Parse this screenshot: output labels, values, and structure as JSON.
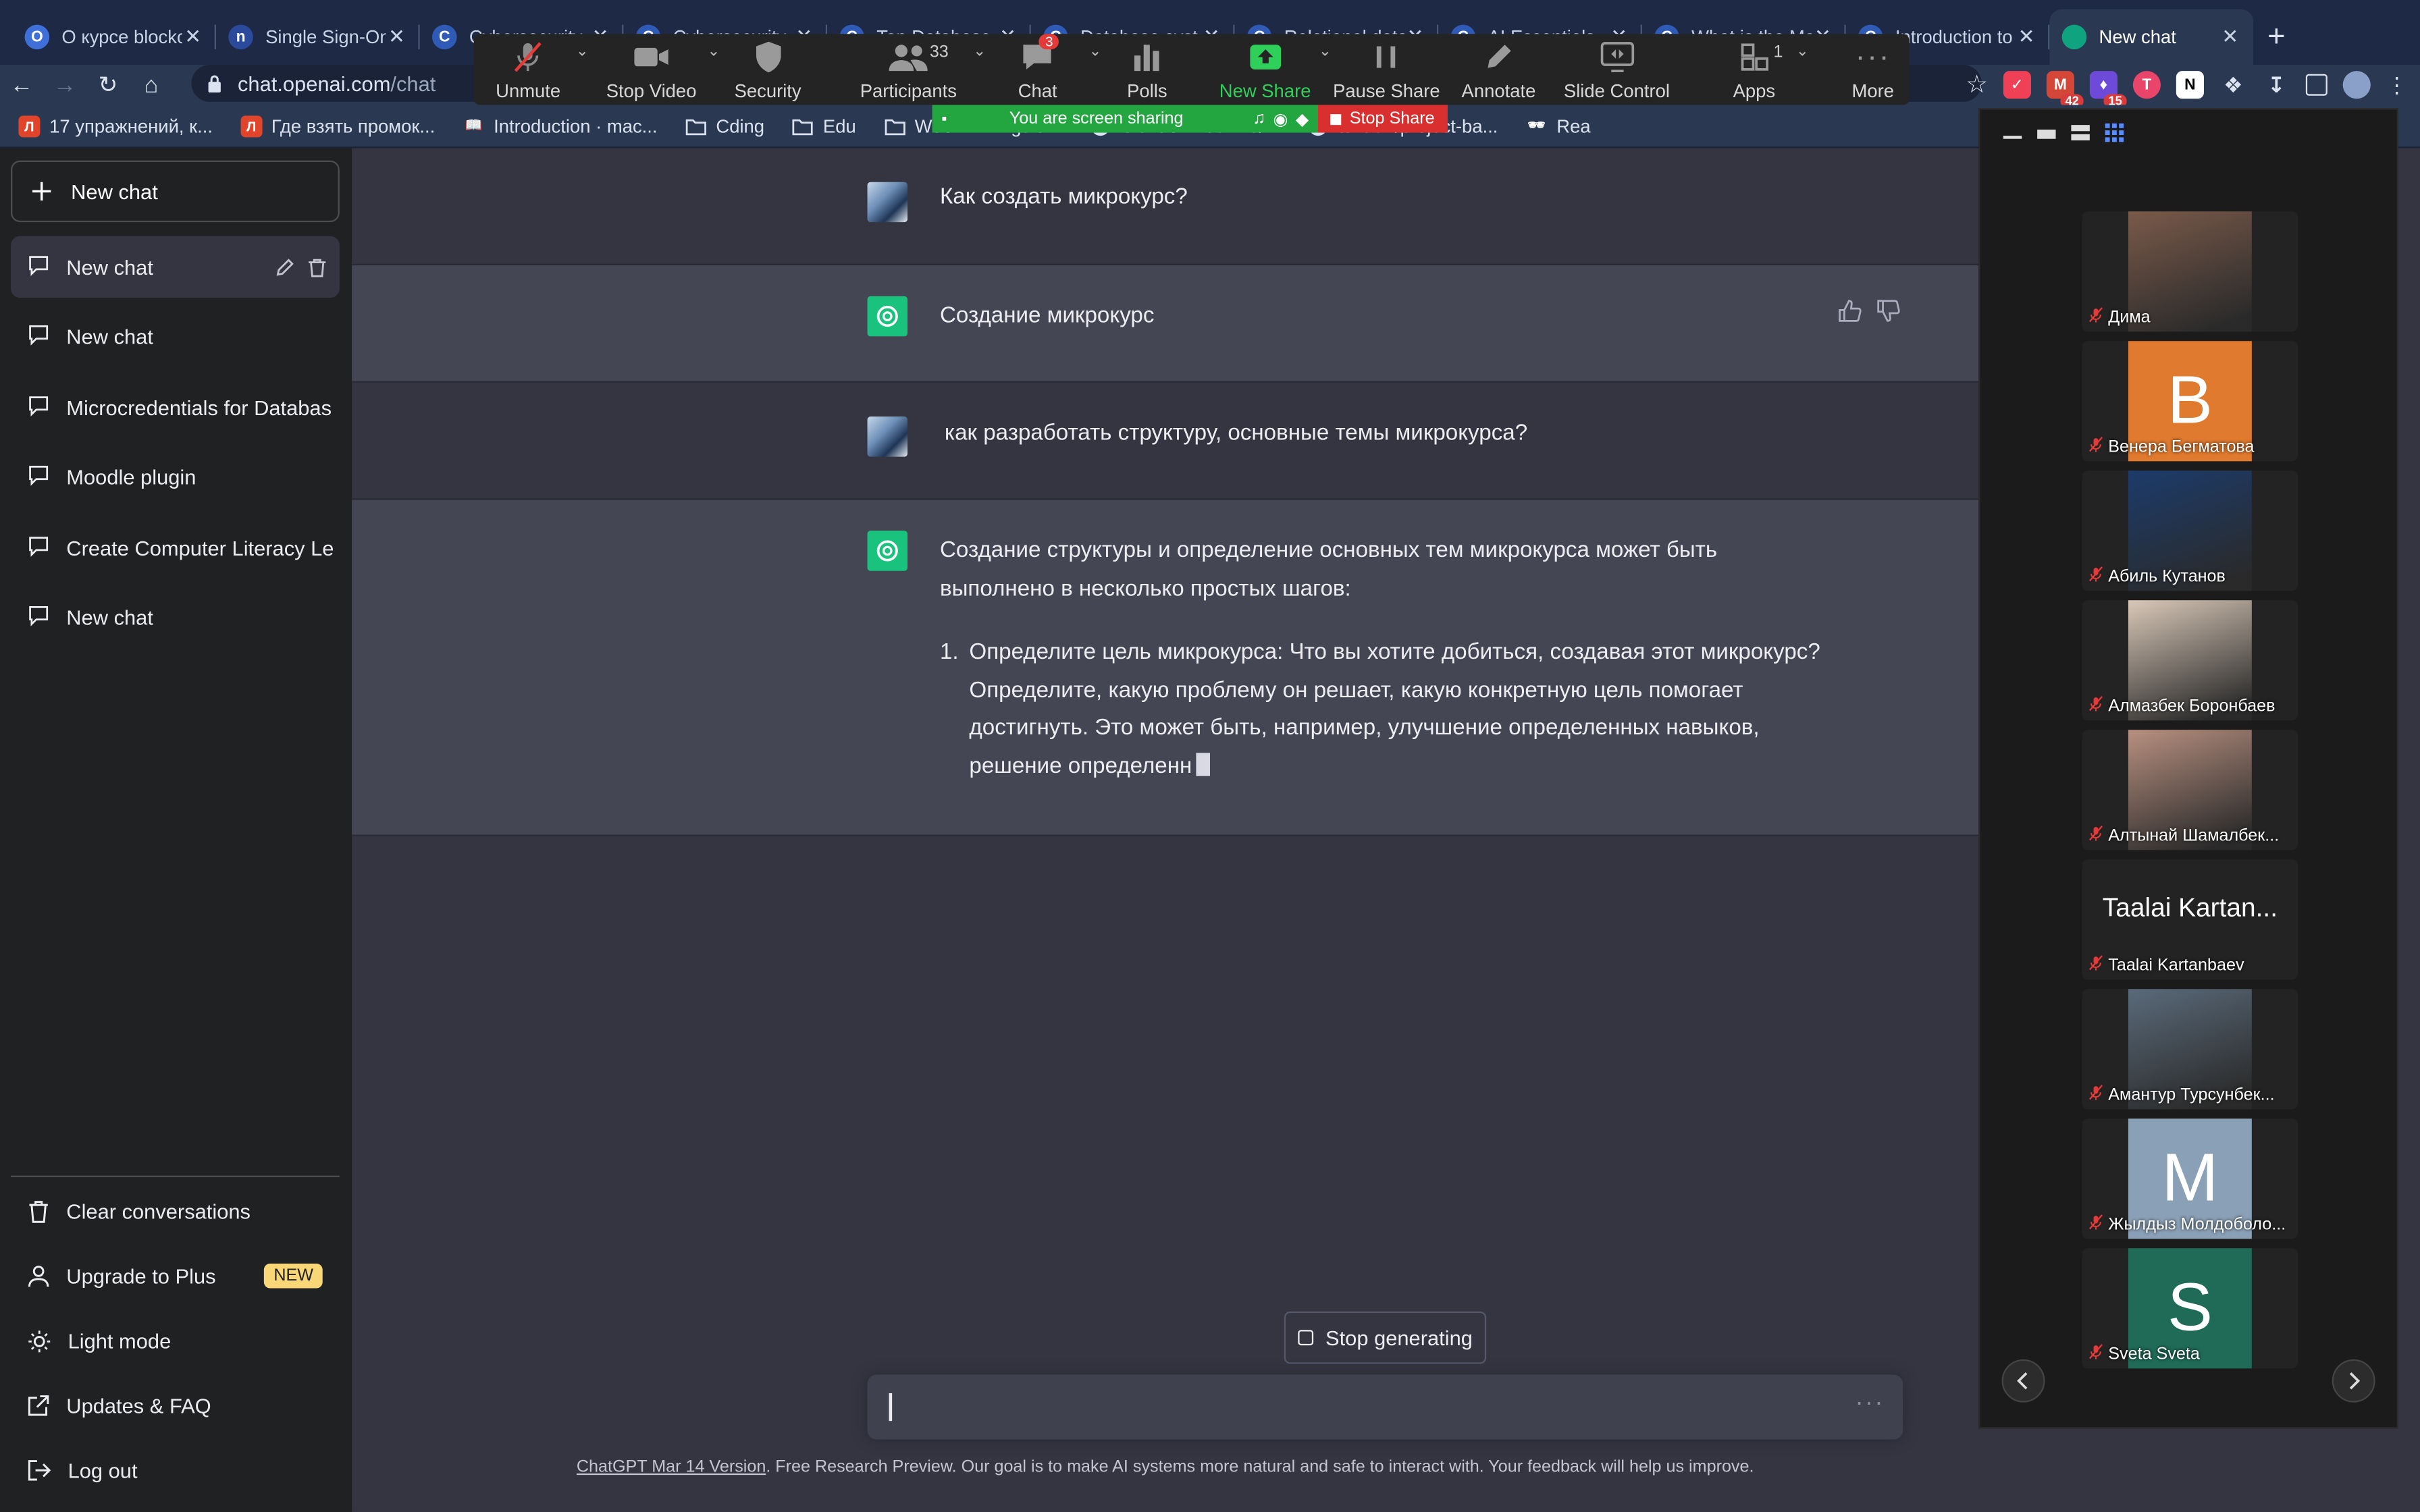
{
  "browser": {
    "tabs": [
      {
        "label": "О курсе blockc",
        "fav": "O",
        "fav_color": "#3f6fd8"
      },
      {
        "label": "Single Sign-On",
        "fav": "n",
        "fav_color": "#2b4a9b"
      },
      {
        "label": "Cybersecurity",
        "fav": "C",
        "fav_color": "#2f5bb7"
      },
      {
        "label": "Cybersecurity",
        "fav": "C",
        "fav_color": "#2f5bb7"
      },
      {
        "label": "Top Database",
        "fav": "C",
        "fav_color": "#2f5bb7"
      },
      {
        "label": "Database syste",
        "fav": "C",
        "fav_color": "#2f5bb7"
      },
      {
        "label": "Relational data",
        "fav": "C",
        "fav_color": "#2f5bb7"
      },
      {
        "label": "AI Essentials",
        "fav": "C",
        "fav_color": "#2f5bb7"
      },
      {
        "label": "What is the Ma",
        "fav": "C",
        "fav_color": "#2f5bb7"
      },
      {
        "label": "Introduction to",
        "fav": "C",
        "fav_color": "#2f5bb7"
      },
      {
        "label": "New chat",
        "fav": "",
        "fav_color": "#10a37f"
      }
    ],
    "url_host": "chat.openai.com",
    "url_path": "/chat",
    "ext_badge_1": "42",
    "ext_badge_2": "15",
    "bookmarks": [
      {
        "label": "17 упражнений, к...",
        "icon": "Л",
        "color": "#e0452b"
      },
      {
        "label": "Где взять промок...",
        "icon": "Л",
        "color": "#e0452b"
      },
      {
        "label": "Introduction · mac...",
        "icon": "📖",
        "color": "transparent"
      },
      {
        "label": "Cding",
        "icon": "folder",
        "color": "transparent"
      },
      {
        "label": "Edu",
        "icon": "folder",
        "color": "transparent"
      },
      {
        "label": "Web",
        "icon": "folder",
        "color": "transparent"
      },
      {
        "label": "guid...",
        "icon": "",
        "color": "transparent"
      },
      {
        "label": "GitHub - 4eckme/...",
        "icon": "github",
        "color": "transparent"
      },
      {
        "label": "tuvtran/project-ba...",
        "icon": "github",
        "color": "transparent"
      },
      {
        "label": "Rea",
        "icon": "🕶",
        "color": "transparent"
      }
    ]
  },
  "zoom": {
    "toolbar": {
      "unmute": "Unmute",
      "stop_video": "Stop Video",
      "security": "Security",
      "participants": "Participants",
      "participants_count": "33",
      "chat": "Chat",
      "chat_badge": "3",
      "polls": "Polls",
      "new_share": "New Share",
      "pause_share": "Pause Share",
      "annotate": "Annotate",
      "slide_control": "Slide Control",
      "apps": "Apps",
      "apps_count": "1",
      "more": "More"
    },
    "sharing_text": "You are screen sharing",
    "stop_share": "Stop Share",
    "participants": [
      {
        "name": "Дима",
        "kind": "photo",
        "color": "#7a5a4a"
      },
      {
        "name": "Венера Бегматова",
        "kind": "letter",
        "letter": "B",
        "color": "#e07a2e"
      },
      {
        "name": "Абиль Кутанов",
        "kind": "photo",
        "color": "#1c3b6b"
      },
      {
        "name": "Алмазбек Боронбаев",
        "kind": "photo",
        "color": "#d9c8b8"
      },
      {
        "name": "Алтынай Шамалбек...",
        "kind": "photo",
        "color": "#b89080"
      },
      {
        "name": "Taalai Kartanbaev",
        "kind": "name",
        "big": "Taalai Kartan...",
        "color": "#232323"
      },
      {
        "name": "Амантур Турсунбек...",
        "kind": "photo",
        "color": "#5a6a7a"
      },
      {
        "name": "Жылдыз Молдоболо...",
        "kind": "letter",
        "letter": "M",
        "color": "#8aa0b6"
      },
      {
        "name": "Sveta Sveta",
        "kind": "letter",
        "letter": "S",
        "color": "#1f6b57"
      }
    ]
  },
  "sidebar": {
    "new_chat": "New chat",
    "history": [
      {
        "label": "New chat",
        "active": true
      },
      {
        "label": "New chat",
        "active": false
      },
      {
        "label": "Microcredentials for Databas",
        "active": false
      },
      {
        "label": "Moodle plugin",
        "active": false
      },
      {
        "label": "Create Computer Literacy Le",
        "active": false
      },
      {
        "label": "New chat",
        "active": false
      }
    ],
    "clear": "Clear conversations",
    "upgrade": "Upgrade to Plus",
    "upgrade_badge": "NEW",
    "light_mode": "Light mode",
    "updates": "Updates & FAQ",
    "logout": "Log out"
  },
  "chat": {
    "messages": [
      {
        "role": "user",
        "text": "Как создать микрокурс?"
      },
      {
        "role": "assistant",
        "text": "Создание микрокурс"
      },
      {
        "role": "user",
        "text": "как разработать структуру, основные темы микрокурса?"
      },
      {
        "role": "assistant",
        "paragraph_line1": "Создание структуры и определение основных тем микрокурса может быть",
        "paragraph_line2": "выполнено в несколько простых шагов:",
        "list_number": "1.",
        "list_line1": "Определите цель микрокурса: Что вы хотите добиться, создавая этот микрокурс?",
        "list_line2": "Определите, какую проблему он решает, какую конкретную цель помогает",
        "list_line3": "достигнуть. Это может быть, например, улучшение определенных навыков,",
        "list_line4": "решение определенн"
      }
    ],
    "stop_generating": "Stop generating",
    "input_placeholder": "",
    "disclaimer_link": "ChatGPT Mar 14 Version",
    "disclaimer_rest": ". Free Research Preview. Our goal is to make AI systems more natural and safe to interact with. Your feedback will help us improve."
  }
}
